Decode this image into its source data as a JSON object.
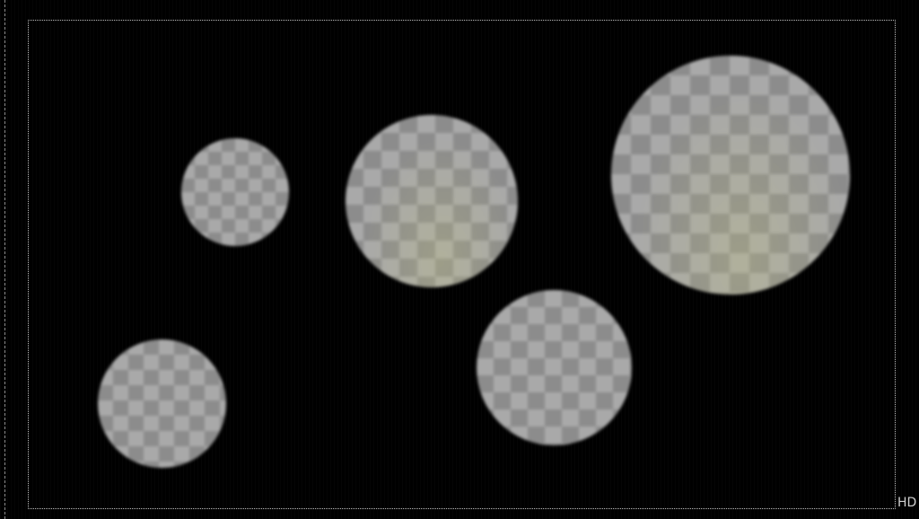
{
  "viewer": {
    "format_label": "HD",
    "background_color": "#000000",
    "frame_color": "#bdbdbd",
    "disc_colors": [
      "#8c8c8c",
      "#a9a9a9"
    ]
  },
  "shapes": [
    {
      "name": "disc-small-top"
    },
    {
      "name": "disc-medium-center"
    },
    {
      "name": "disc-large-right"
    },
    {
      "name": "disc-bottom-left"
    },
    {
      "name": "disc-bottom-center"
    }
  ]
}
